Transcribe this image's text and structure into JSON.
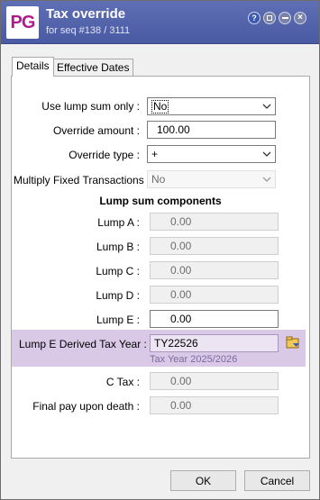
{
  "window": {
    "logo_text": "PG",
    "title": "Tax override",
    "subtitle": "for seq #138 / 3111"
  },
  "titlebar_buttons": {
    "help_glyph": "?",
    "close_glyph": "×"
  },
  "tabs": [
    {
      "label": "Details",
      "active": true
    },
    {
      "label": "Effective Dates",
      "active": false
    }
  ],
  "form": {
    "use_lump_sum_only": {
      "label": "Use lump sum only :",
      "value": "No"
    },
    "override_amount": {
      "label": "Override amount :",
      "value": "100.00"
    },
    "override_type": {
      "label": "Override type :",
      "value": "+"
    },
    "multiply_fixed": {
      "label": "Multiply Fixed Transactions :",
      "value": "No"
    },
    "section_title": "Lump sum components",
    "lump_a": {
      "label": "Lump A :",
      "value": "0.00"
    },
    "lump_b": {
      "label": "Lump B :",
      "value": "0.00"
    },
    "lump_c": {
      "label": "Lump C :",
      "value": "0.00"
    },
    "lump_d": {
      "label": "Lump D :",
      "value": "0.00"
    },
    "lump_e": {
      "label": "Lump E :",
      "value": "0.00"
    },
    "lump_e_tax_year": {
      "label": "Lump E Derived Tax Year :",
      "value": "TY22526",
      "note": "Tax Year 2025/2026"
    },
    "c_tax": {
      "label": "C Tax :",
      "value": "0.00"
    },
    "final_pay": {
      "label": "Final pay upon death :",
      "value": "0.00"
    }
  },
  "buttons": {
    "ok": "OK",
    "cancel": "Cancel"
  },
  "colors": {
    "titlebar": "#4a5aa3",
    "logo": "#b01a8f",
    "highlight_band": "#d9c8e6"
  },
  "icons": [
    "help-icon",
    "restore-icon",
    "minimize-icon",
    "close-icon",
    "chevron-down-icon",
    "lookup-icon"
  ]
}
